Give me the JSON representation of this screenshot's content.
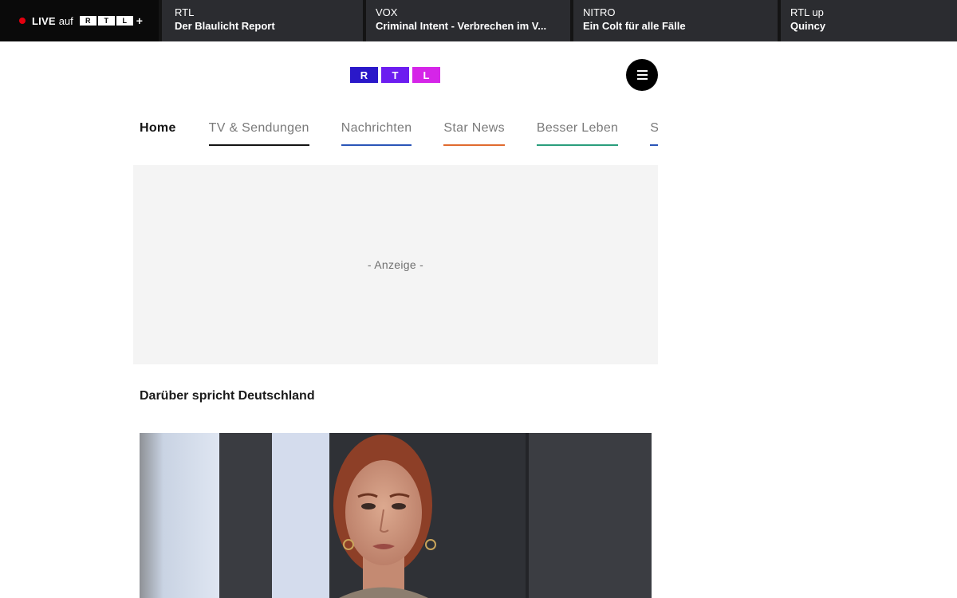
{
  "livebar": {
    "live_label": "LIVE",
    "auf_label": "auf",
    "logo_letters": [
      "R",
      "T",
      "L"
    ],
    "plus_label": "+",
    "channels": [
      {
        "name": "RTL",
        "show": "Der Blaulicht Report"
      },
      {
        "name": "VOX",
        "show": "Criminal Intent - Verbrechen im V..."
      },
      {
        "name": "NITRO",
        "show": "Ein Colt für alle Fälle"
      },
      {
        "name": "RTL up",
        "show": "Quincy"
      }
    ]
  },
  "header": {
    "logo_letters": [
      "R",
      "T",
      "L"
    ],
    "logo_colors": [
      "#2a18c9",
      "#6c1df0",
      "#d525e8"
    ],
    "menu_icon": "hamburger-menu-icon"
  },
  "nav": {
    "items": [
      {
        "label": "Home",
        "active": true
      },
      {
        "label": "TV & Sendungen",
        "underline": "#141414"
      },
      {
        "label": "Nachrichten",
        "underline": "#2a55b8"
      },
      {
        "label": "Star News",
        "underline": "#e06a2f"
      },
      {
        "label": "Besser Leben",
        "underline": "#2a9e7c"
      },
      {
        "label": "Sport",
        "underline": "#2a55b8"
      }
    ]
  },
  "ad": {
    "label": "- Anzeige -"
  },
  "section": {
    "title": "Darüber spricht Deutschland"
  }
}
